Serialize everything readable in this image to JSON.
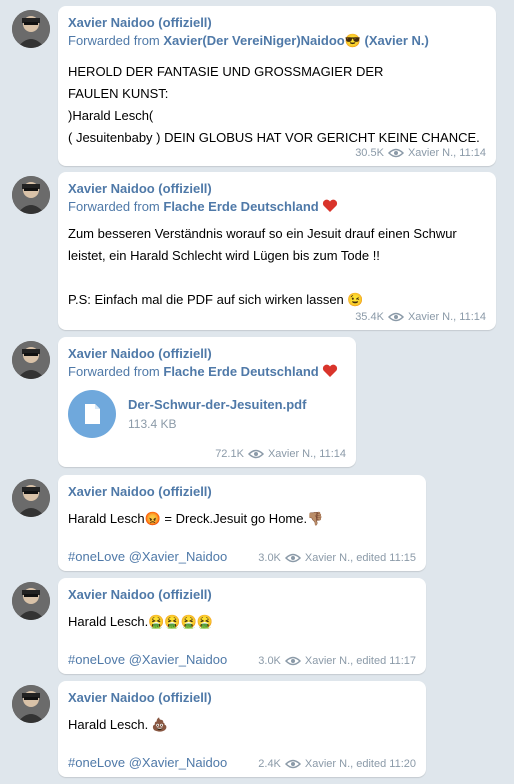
{
  "channel": {
    "sender_name": "Xavier Naidoo (offiziell)"
  },
  "messages": [
    {
      "forwarded_prefix": "Forwarded from ",
      "forwarded_from": "Xavier(Der VereiNiger)Naidoo😎 (Xavier N.)",
      "lines": [
        "HEROLD DER FANTASIE UND GROSSMAGIER DER",
        "FAULEN KUNST:",
        ")Harald Lesch(",
        "( Jesuitenbaby ) DEIN GLOBUS HAT VOR GERICHT KEINE CHANCE."
      ],
      "views": "30.5K",
      "author_time": "Xavier N., 11:14"
    },
    {
      "forwarded_prefix": "Forwarded from ",
      "forwarded_from": "Flache Erde Deutschland",
      "forwarded_emoji": "heart",
      "lines": [
        "Zum besseren Verständnis worauf so ein Jesuit drauf einen Schwur",
        "leistet, ein Harald Schlecht wird Lügen bis zum Tode !!",
        "",
        "P.S: Einfach mal die PDF auf sich wirken lassen 😉"
      ],
      "views": "35.4K",
      "author_time": "Xavier N., 11:14"
    },
    {
      "forwarded_prefix": "Forwarded from ",
      "forwarded_from": "Flache Erde Deutschland",
      "forwarded_emoji": "heart",
      "file": {
        "name": "Der-Schwur-der-Jesuiten.pdf",
        "size": "113.4 KB",
        "icon": "document-icon"
      },
      "views": "72.1K",
      "author_time": "Xavier N., 11:14"
    },
    {
      "text": "Harald Lesch😡 = Dreck.Jesuit go Home.👎🏽",
      "hashtags": "#oneLove @Xavier_Naidoo",
      "views": "3.0K",
      "author_time": "Xavier N., edited  11:15"
    },
    {
      "text": "Harald Lesch.🤮🤮🤮🤮",
      "hashtags": "#oneLove @Xavier_Naidoo",
      "views": "3.0K",
      "author_time": "Xavier N., edited  11:17"
    },
    {
      "text": "Harald Lesch. 💩",
      "hashtags": "#oneLove @Xavier_Naidoo",
      "views": "2.4K",
      "author_time": "Xavier N., edited  11:20"
    }
  ]
}
